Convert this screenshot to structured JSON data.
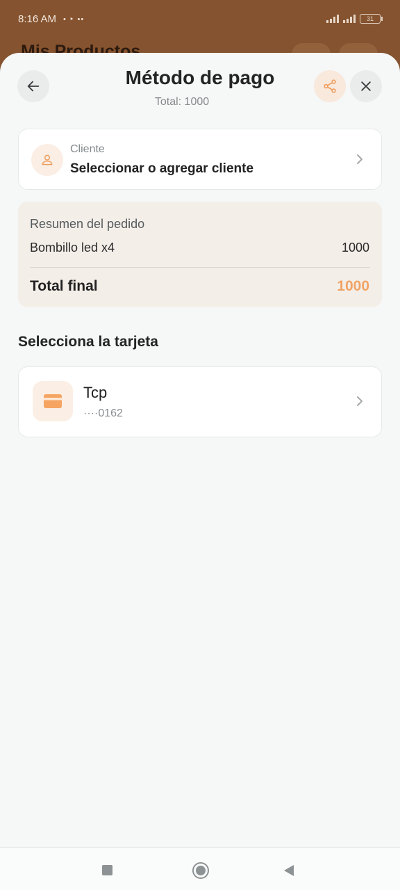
{
  "status_bar": {
    "time": "8:16 AM",
    "indicators": "• ‣ ••",
    "battery": "31"
  },
  "background_app": {
    "title": "Mis Productos"
  },
  "header": {
    "title": "Método de pago",
    "subtitle": "Total: 1000",
    "back_icon": "arrow-left-icon",
    "share_icon": "share-icon",
    "close_icon": "close-icon"
  },
  "client": {
    "label": "Cliente",
    "value": "Seleccionar o agregar cliente",
    "icon": "user-icon"
  },
  "summary": {
    "heading": "Resumen del pedido",
    "items": [
      {
        "name": "Bombillo led x4",
        "amount": "1000"
      }
    ],
    "total_label": "Total final",
    "total_value": "1000"
  },
  "cards_section": {
    "title": "Selecciona la tarjeta",
    "cards": [
      {
        "name": "Tcp",
        "number": "····0162",
        "icon": "credit-card-icon"
      }
    ]
  },
  "colors": {
    "accent": "#f0a466",
    "accent_bg": "#fbeee4",
    "sheet_bg": "#f6f7f7",
    "brand_brown": "#85532f"
  },
  "navbar": {
    "icons": [
      "recents-icon",
      "home-icon",
      "back-triangle-icon"
    ]
  }
}
